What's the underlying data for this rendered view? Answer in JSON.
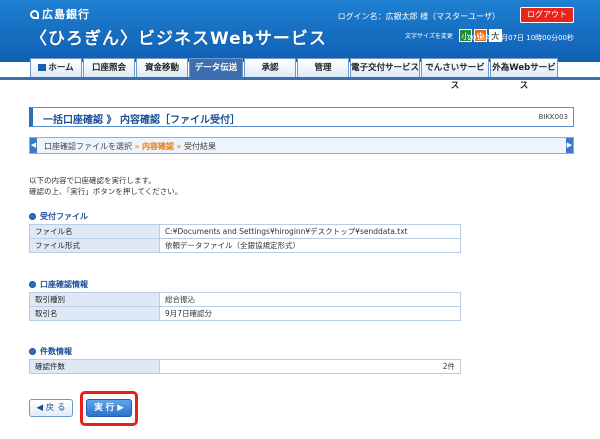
{
  "header": {
    "bank_name": "広島銀行",
    "service_name": "〈ひろぎん〉ビジネスWebサービス",
    "login_label": "ログイン名：広銀太郎 様（マスターユーザ）",
    "logout_label": "ログアウト",
    "font_size_label": "文字サイズを変更",
    "font_small": "小",
    "font_medium": "中",
    "font_large": "大",
    "datetime": "2016年09月07日 10時00分00秒"
  },
  "nav": {
    "tabs": [
      {
        "label": "ホーム"
      },
      {
        "label": "口座照会"
      },
      {
        "label": "資金移動"
      },
      {
        "label": "データ伝送"
      },
      {
        "label": "承認"
      },
      {
        "label": "管理"
      },
      {
        "label": "電子交付サービス"
      },
      {
        "label": "でんさいサービス"
      },
      {
        "label": "外為Webサービス"
      }
    ]
  },
  "page": {
    "title": "一括口座確認 》 内容確認［ファイル受付］",
    "screen_id": "BIKK003",
    "steps": {
      "step1": "口座確認ファイルを選択",
      "sep": "»",
      "step2": "内容確認",
      "step3": "受付結果"
    },
    "intro_line1": "以下の内容で口座確認を実行します。",
    "intro_line2": "確認の上、「実行」ボタンを押してください。"
  },
  "file_section": {
    "title": "受付ファイル",
    "rows": [
      {
        "label": "ファイル名",
        "value": "C:¥Documents and Settings¥hiroginn¥デスクトップ¥senddata.txt"
      },
      {
        "label": "ファイル形式",
        "value": "依頼データファイル（全銀協規定形式）"
      }
    ]
  },
  "account_section": {
    "title": "口座確認情報",
    "rows": [
      {
        "label": "取引種別",
        "value": "総合振込"
      },
      {
        "label": "取引名",
        "value": "9月7日確認分"
      }
    ]
  },
  "count_section": {
    "title": "件数情報",
    "rows": [
      {
        "label": "確認件数",
        "value": "2件"
      }
    ]
  },
  "buttons": {
    "back": "戻 る",
    "execute": "実 行"
  },
  "colors": {
    "header_blue": "#1a6fc4",
    "accent_orange": "#ec7a16",
    "logout_red": "#e8251b",
    "highlight_red": "#e8201a"
  }
}
